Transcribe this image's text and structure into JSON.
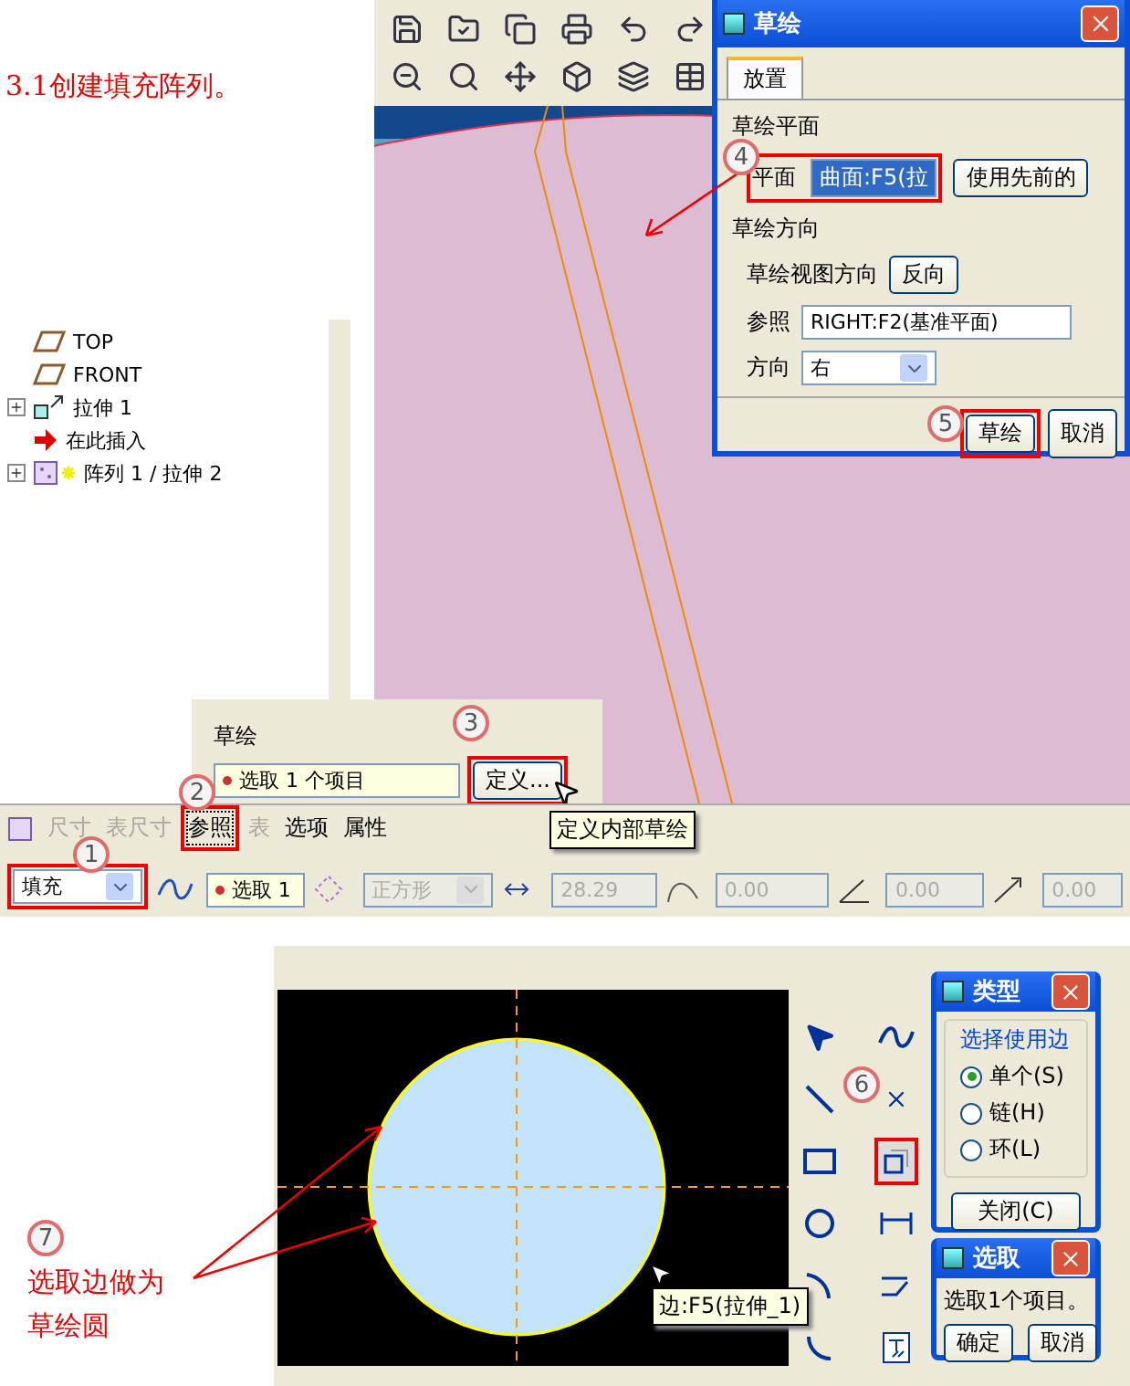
{
  "heading": "3.1创建填充阵列。",
  "model_tree": {
    "items": [
      {
        "label": "TOP",
        "kind": "plane"
      },
      {
        "label": "FRONT",
        "kind": "plane"
      },
      {
        "label": "拉伸 1",
        "kind": "extrude",
        "expanded": false
      },
      {
        "label": "在此插入",
        "kind": "insert"
      },
      {
        "label": "阵列 1 / 拉伸 2",
        "kind": "pattern",
        "expanded": false
      }
    ]
  },
  "sketch_dialog": {
    "title": "草绘",
    "tabs": [
      {
        "label": "放置",
        "selected": true
      }
    ],
    "plane_group": "草绘平面",
    "plane_label": "平面",
    "plane_value": "曲面:F5(拉",
    "plane_highlighted": true,
    "use_previous": "使用先前的",
    "orientation_group": "草绘方向",
    "view_dir_label": "草绘视图方向",
    "flip": "反向",
    "reference_label": "参照",
    "reference_value": "RIGHT:F2(基准平面)",
    "direction_label": "方向",
    "direction_value": "右",
    "ok": "草绘",
    "ok_highlighted": true,
    "cancel": "取消"
  },
  "sketch_panel": {
    "label": "草绘",
    "selection": "选取 1 个项目",
    "define": "定义...",
    "define_highlighted": true,
    "tooltip": "定义内部草绘"
  },
  "dashboard": {
    "tabs": [
      {
        "label": "尺寸",
        "disabled": true,
        "highlighted": false
      },
      {
        "label": "表尺寸",
        "disabled": true,
        "highlighted": false
      },
      {
        "label": "参照",
        "disabled": false,
        "highlighted": true
      },
      {
        "label": "表",
        "disabled": true,
        "highlighted": false
      },
      {
        "label": "选项",
        "disabled": false,
        "highlighted": false
      },
      {
        "label": "属性",
        "disabled": false,
        "highlighted": false
      }
    ],
    "type_value": "填充",
    "type_highlighted": true,
    "sketch_select": "选取 1",
    "shape": "正方形",
    "spacing": "28.29",
    "distance": "0.00",
    "angle": "0.00",
    "radius": "0.00"
  },
  "steps": [
    "1",
    "2",
    "3",
    "4",
    "5",
    "6",
    "7"
  ],
  "sketch_view": {
    "tooltip": "边:F5(拉伸_1)",
    "tool_highlighted": true
  },
  "type_dialog": {
    "title": "类型",
    "group": "选择使用边",
    "options": [
      {
        "label": "单个(S)",
        "selected": true
      },
      {
        "label": "链(H)",
        "selected": false
      },
      {
        "label": "环(L)",
        "selected": false
      }
    ],
    "close": "关闭(C)"
  },
  "select_dialog": {
    "title": "选取",
    "message": "选取1个项目。",
    "ok": "确定",
    "cancel": "取消"
  },
  "annotation": "选取边做为草绘圆"
}
